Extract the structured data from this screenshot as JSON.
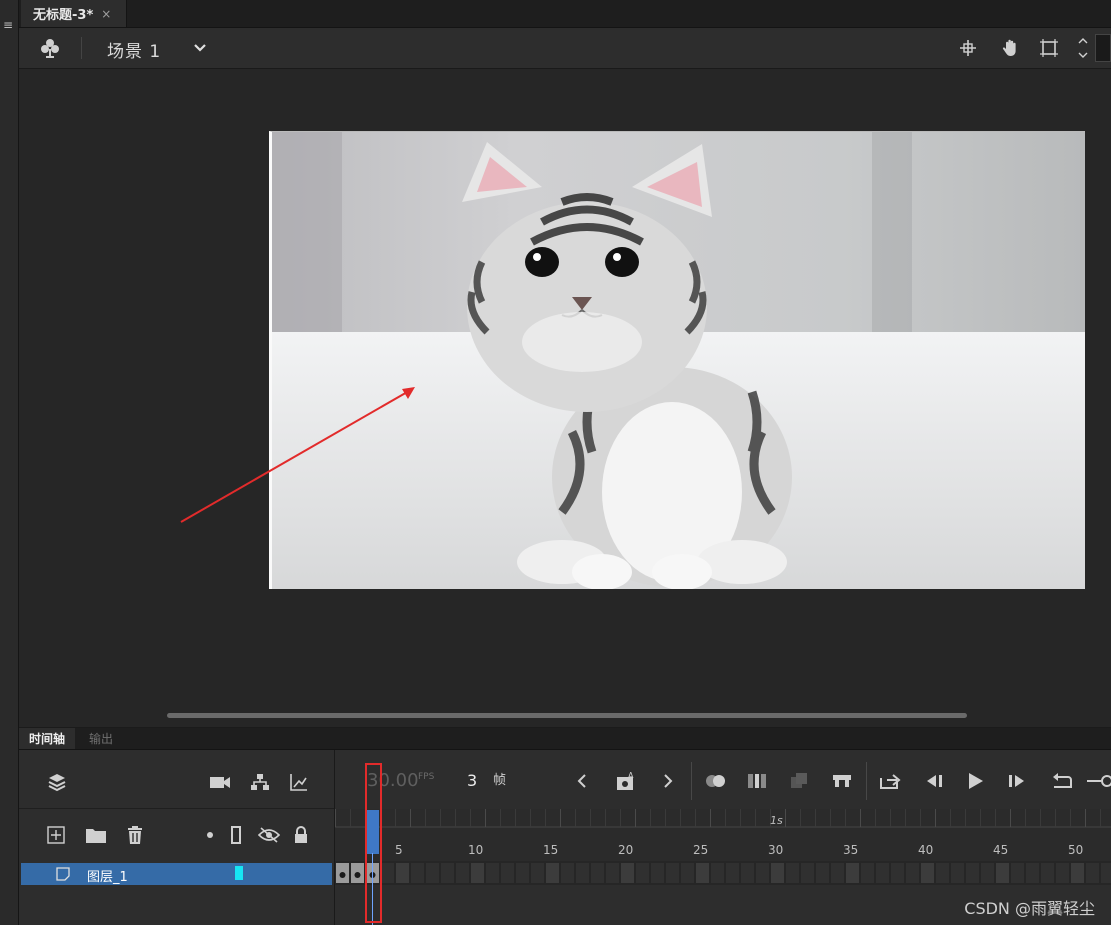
{
  "document_tab": {
    "title": "无标题-3*",
    "close_glyph": "×"
  },
  "scene_bar": {
    "scene_label": "场景 1"
  },
  "panel_tabs": [
    {
      "label": "时间轴"
    },
    {
      "label": "输出"
    }
  ],
  "timeline": {
    "fps_value": "30.00",
    "fps_unit": "FPS",
    "current_frame": "3",
    "frame_unit": "帧",
    "second_marker": "1s",
    "frame_ticks": [
      "5",
      "10",
      "15",
      "20",
      "25",
      "30",
      "35",
      "40",
      "45",
      "50"
    ],
    "layers": [
      {
        "name": "图层_1",
        "color": "#17e5f3"
      }
    ]
  },
  "watermark": "CSDN @雨翼轻尘",
  "colors": {
    "accent": "#3f78c6",
    "annotation": "#e22b2b"
  }
}
